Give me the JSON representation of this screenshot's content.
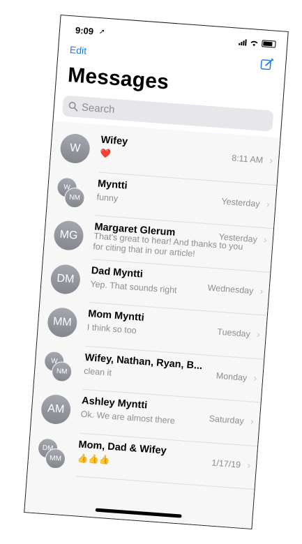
{
  "status_bar": {
    "time": "9:09"
  },
  "nav": {
    "edit_label": "Edit",
    "title": "Messages",
    "accent_color": "#1a7cf5"
  },
  "search": {
    "placeholder": "Search"
  },
  "conversations": [
    {
      "name": "Wifey",
      "initials": "W",
      "preview": "❤️",
      "time": "8:11 AM",
      "group": false
    },
    {
      "name": "Myntti",
      "initials_back": "W",
      "initials_front": "NM",
      "preview": "funny",
      "time": "Yesterday",
      "group": true
    },
    {
      "name": "Margaret Glerum",
      "initials": "MG",
      "preview": "That's great to hear! And thanks to you for citing that in our article!",
      "time": "Yesterday",
      "group": false
    },
    {
      "name": "Dad Myntti",
      "initials": "DM",
      "preview": "Yep. That sounds right",
      "time": "Wednesday",
      "group": false
    },
    {
      "name": "Mom Myntti",
      "initials": "MM",
      "preview": "I think so too",
      "time": "Tuesday",
      "group": false
    },
    {
      "name": "Wifey, Nathan, Ryan, B...",
      "initials_back": "W",
      "initials_front": "NM",
      "preview": "clean it",
      "time": "Monday",
      "group": true
    },
    {
      "name": "Ashley Myntti",
      "initials": "AM",
      "preview": "Ok. We are almost there",
      "time": "Saturday",
      "group": false
    },
    {
      "name": "Mom, Dad & Wifey",
      "initials_back": "DM",
      "initials_front": "MM",
      "preview": "👍👍👍",
      "time": "1/17/19",
      "group": true
    }
  ]
}
